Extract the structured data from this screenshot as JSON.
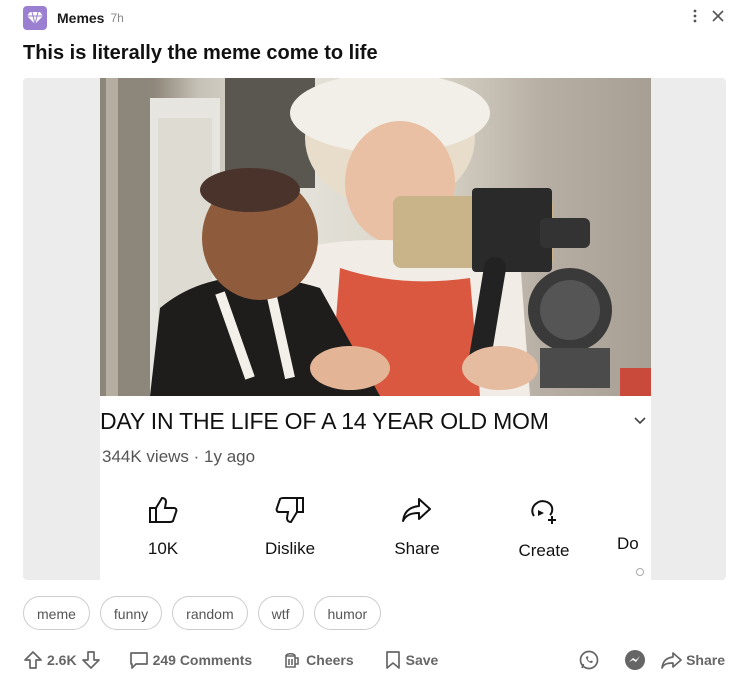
{
  "header": {
    "community": "Memes",
    "time": "7h"
  },
  "post": {
    "title": "This is literally the meme come to life"
  },
  "video": {
    "title": "DAY IN THE LIFE OF A 14 YEAR OLD MOM",
    "meta": "344K views · 1y ago",
    "actions": [
      {
        "label": "10K",
        "icon": "thumbs-up-icon"
      },
      {
        "label": "Dislike",
        "icon": "thumbs-down-icon"
      },
      {
        "label": "Share",
        "icon": "share-arrow-icon"
      },
      {
        "label": "Create",
        "icon": "create-icon"
      },
      {
        "label": "Do",
        "icon": "download-icon"
      }
    ]
  },
  "tags": [
    "meme",
    "funny",
    "random",
    "wtf",
    "humor"
  ],
  "footer": {
    "votes": "2.6K",
    "comments": "249 Comments",
    "cheers": "Cheers",
    "save": "Save",
    "share": "Share"
  },
  "colors": {
    "community_icon": "#9b7fd1"
  }
}
